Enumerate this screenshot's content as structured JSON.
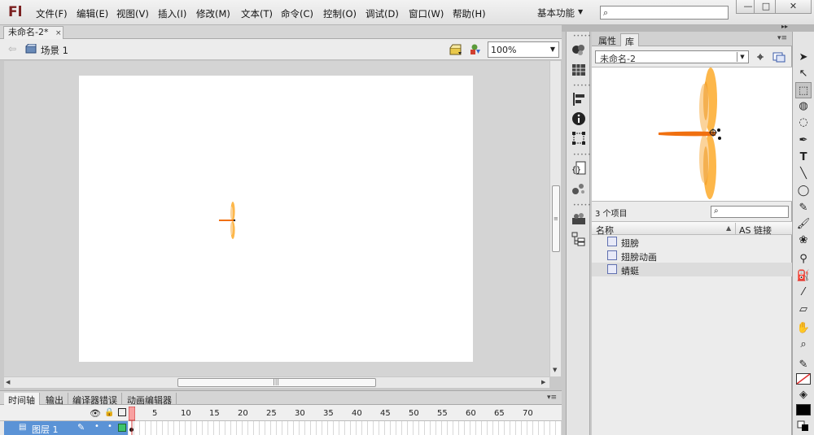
{
  "app": {
    "logo": "Fl",
    "menus": [
      "文件(F)",
      "编辑(E)",
      "视图(V)",
      "插入(I)",
      "修改(M)",
      "文本(T)",
      "命令(C)",
      "控制(O)",
      "调试(D)",
      "窗口(W)",
      "帮助(H)"
    ],
    "workspace": "基本功能",
    "search_placeholder": "",
    "window_buttons": {
      "minimize": "—",
      "maximize": "□",
      "close": "✕"
    }
  },
  "document": {
    "tab_label": "未命名-2*",
    "tab_close": "×",
    "scene_label": "场景 1",
    "zoom": "100%"
  },
  "timeline": {
    "tabs": [
      "时间轴",
      "输出",
      "编译器错误",
      "动画编辑器"
    ],
    "frame_numbers": [
      "1",
      "5",
      "10",
      "15",
      "20",
      "25",
      "30",
      "35",
      "40",
      "45",
      "50",
      "55",
      "60",
      "65",
      "70"
    ],
    "layer_name": "图层 1"
  },
  "panels": {
    "tabs": [
      "属性",
      "库"
    ],
    "active_tab": "库",
    "library_document": "未命名-2",
    "item_count": "3 个项目",
    "columns": {
      "name": "名称",
      "linkage": "AS 链接"
    },
    "items": [
      {
        "label": "翅膀",
        "selected": false
      },
      {
        "label": "翅膀动画",
        "selected": false
      },
      {
        "label": "蜻蜓",
        "selected": true
      }
    ]
  },
  "icons": {
    "tools": [
      "selection-icon",
      "subselection-icon",
      "free-transform-icon",
      "3d-rotation-icon",
      "lasso-icon",
      "pen-icon",
      "text-icon",
      "line-icon",
      "oval-icon",
      "pencil-icon",
      "brush-icon",
      "deco-icon",
      "bone-icon",
      "paint-bucket-icon",
      "eyedropper-icon",
      "eraser-icon",
      "hand-icon",
      "zoom-icon",
      "stroke-color-icon",
      "fill-color-icon"
    ]
  },
  "colors": {
    "dragonfly_body": "#f07010",
    "dragonfly_wing": "#fdb74a",
    "layer_highlight": "#5b93d6"
  }
}
